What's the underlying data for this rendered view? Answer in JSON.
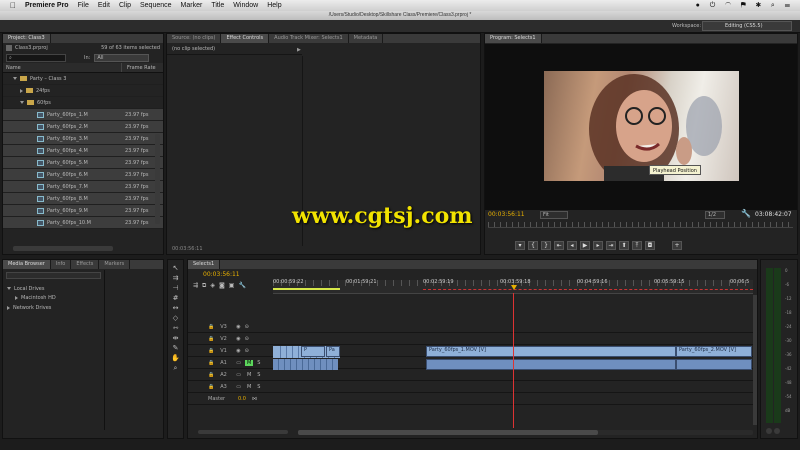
{
  "menubar": {
    "apple": "",
    "app": "Premiere Pro",
    "items": [
      "File",
      "Edit",
      "Clip",
      "Sequence",
      "Marker",
      "Title",
      "Window",
      "Help"
    ],
    "time": "",
    "status_icons": [
      "record-icon",
      "power-icon",
      "wifi-icon",
      "flag-icon",
      "bluetooth-icon",
      "search-icon",
      "list-icon"
    ]
  },
  "titlebar": {
    "path": "/Users/Studio/Desktop/Skillshare Class/Premiere/Class3.prproj *"
  },
  "workspace": {
    "label": "Workspace:",
    "value": "Editing (CS5.5)"
  },
  "project": {
    "tab": "Project: Class3",
    "file": "Class3.prproj",
    "count": "59 of 63 items selected",
    "in_label": "In:",
    "in_value": "All",
    "col_name": "Name",
    "col_rate": "Frame Rate",
    "bin": "Party – Class 3",
    "folders": [
      "24fps",
      "60fps"
    ],
    "clips": [
      {
        "name": "Party_60fps_1.M",
        "rate": "23.97 fps"
      },
      {
        "name": "Party_60fps_2.M",
        "rate": "23.97 fps"
      },
      {
        "name": "Party_60fps_3.M",
        "rate": "23.97 fps"
      },
      {
        "name": "Party_60fps_4.M",
        "rate": "23.97 fps"
      },
      {
        "name": "Party_60fps_5.M",
        "rate": "23.97 fps"
      },
      {
        "name": "Party_60fps_6.M",
        "rate": "23.97 fps"
      },
      {
        "name": "Party_60fps_7.M",
        "rate": "23.97 fps"
      },
      {
        "name": "Party_60fps_8.M",
        "rate": "23.97 fps"
      },
      {
        "name": "Party_60fps_9.M",
        "rate": "23.97 fps"
      },
      {
        "name": "Party_60fps_10.M",
        "rate": "23.97 fps"
      }
    ]
  },
  "source": {
    "tabs": [
      "Source: (no clips)",
      "Effect Controls",
      "Audio Track Mixer: Selects1",
      "Metadata"
    ],
    "active": 1,
    "no_clip": "(no clip selected)",
    "timecode": "00:03:56:11"
  },
  "program": {
    "tab": "Program: Selects1",
    "timecode": "00:03:56:11",
    "fit": "Fit",
    "resolution": "1/2",
    "duration": "03:08:42:07",
    "tooltip": "Playhead Position"
  },
  "watermark": "www.cgtsj.com",
  "media": {
    "tabs": [
      "Media Browser",
      "Info",
      "Effects",
      "Markers"
    ],
    "local": "Local Drives",
    "drive": "Macintosh HD",
    "network": "Network Drives"
  },
  "timeline": {
    "tab": "Selects1",
    "timecode": "00:03:56:11",
    "ruler": [
      "00:00:59:22",
      "00:01:59:21",
      "00:02:59:19",
      "00:03:59:18",
      "00:04:59:16",
      "00:05:59:15",
      "00:06:5"
    ],
    "video_tracks": [
      "V3",
      "V2",
      "V1"
    ],
    "audio_tracks": [
      "A1",
      "A2",
      "A3"
    ],
    "master": "Master",
    "master_value": "0.0",
    "clip1": "Party_60fps_1.MOV [V]",
    "clip2": "Party_60fps_2.MOV [V]",
    "small_clips": [
      "P",
      "Pa"
    ],
    "m_label": "M",
    "s_label": "S"
  },
  "meter": {
    "ticks": [
      "0",
      "-6",
      "-12",
      "-18",
      "-24",
      "-30",
      "-36",
      "-42",
      "-48",
      "-54"
    ],
    "unit": "dB"
  }
}
